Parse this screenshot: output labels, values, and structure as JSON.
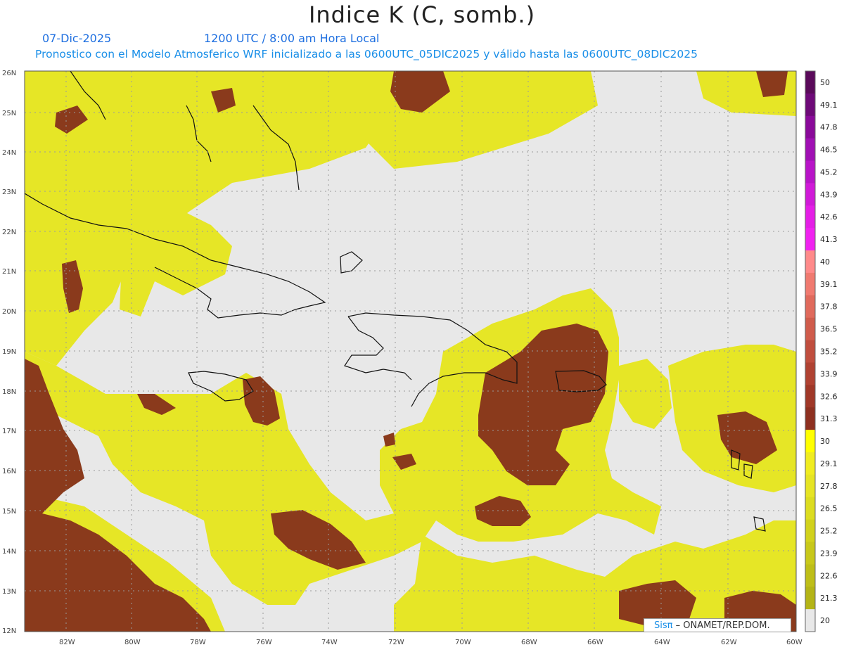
{
  "header": {
    "title": "Indice K (C, somb.)",
    "date": "07-Dic-2025",
    "time": "1200 UTC / 8:00 am Hora Local",
    "description": "Pronostico con el Modelo Atmosferico WRF inicializado a las 0600UTC_05DIC2025 y válido hasta las  0600UTC_08DIC2025"
  },
  "map": {
    "lat_labels": [
      "26N",
      "25N",
      "24N",
      "23N",
      "22N",
      "21N",
      "20N",
      "19N",
      "18N",
      "17N",
      "16N",
      "15N",
      "14N",
      "13N",
      "12N"
    ],
    "lon_labels": [
      "82W",
      "80W",
      "78W",
      "76W",
      "74W",
      "72W",
      "70W",
      "68W",
      "66W",
      "64W",
      "62W",
      "60W"
    ],
    "colors": {
      "none": "#e8e8e8",
      "yellow_light": "#f4f430",
      "yellow": "#e8e820",
      "olive": "#c8c820",
      "brown": "#8a3a1c",
      "brown_dark": "#7a2e14"
    }
  },
  "colorbar": {
    "labels": [
      "50",
      "49.1",
      "47.8",
      "46.5",
      "45.2",
      "43.9",
      "42.6",
      "41.3",
      "40",
      "39.1",
      "37.8",
      "36.5",
      "35.2",
      "33.9",
      "32.6",
      "31.3",
      "30",
      "29.1",
      "27.8",
      "26.5",
      "25.2",
      "23.9",
      "22.6",
      "21.3",
      "20"
    ],
    "colors": [
      "#5a0a5a",
      "#6e0a78",
      "#8a0a9a",
      "#a010b4",
      "#b814c8",
      "#d01ad8",
      "#e41ee6",
      "#f022f0",
      "#ff8a8a",
      "#f07a70",
      "#e06a5c",
      "#d05c4c",
      "#c04e3e",
      "#b04232",
      "#a03828",
      "#8e3020",
      "#ffff00",
      "#f0ec20",
      "#e6e424",
      "#dcdc20",
      "#d2d21c",
      "#c8c81a",
      "#bebe18",
      "#b4b416",
      "#e8e8e8"
    ]
  },
  "logo": {
    "brand": "Sisπ",
    "text": "– ONAMET/REP.DOM."
  }
}
